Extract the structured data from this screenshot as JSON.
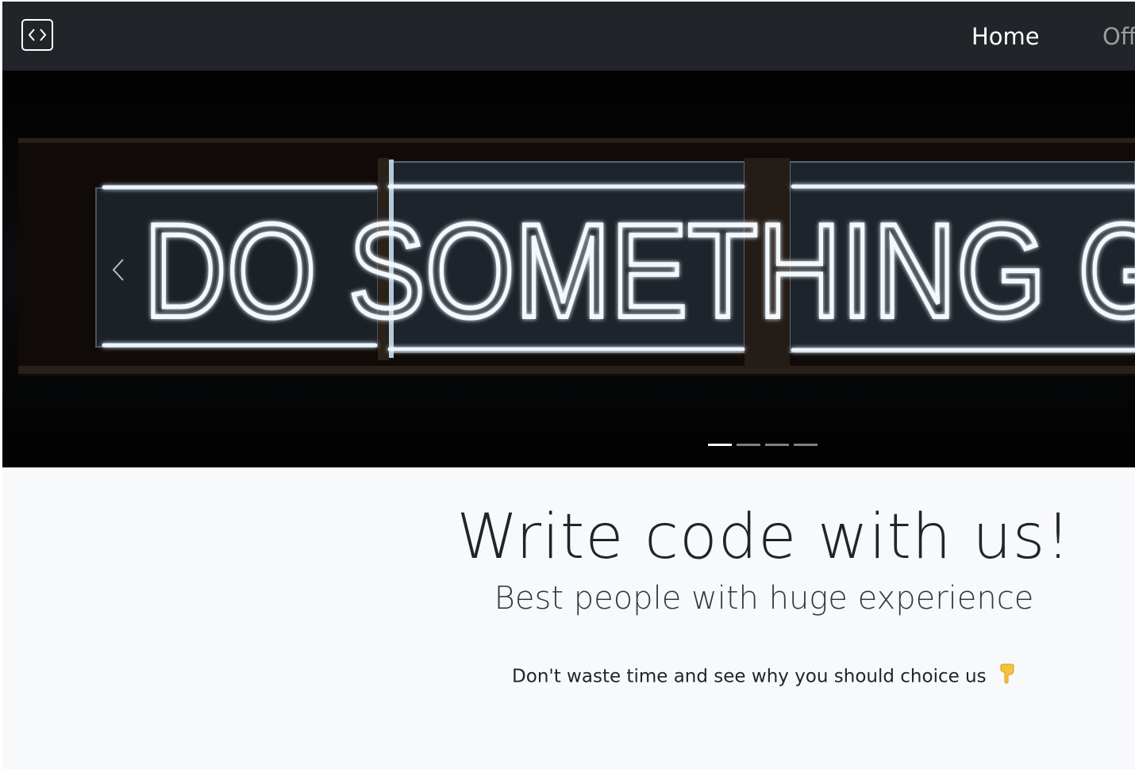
{
  "navbar": {
    "brand_icon": "code-brackets-icon",
    "links": [
      {
        "label": "Home"
      },
      {
        "label": "Off"
      }
    ]
  },
  "carousel": {
    "slide_text": "DO SOMETHING G",
    "prev_icon": "chevron-left-icon",
    "indicator_count": 4,
    "active_index": 0
  },
  "hero": {
    "title": "Write code with us!",
    "subtitle": "Best people with huge experience",
    "cta": "Don't waste time and see why you should choice us",
    "cta_icon": "pointing-down-hand-icon"
  },
  "colors": {
    "navbar_bg": "#212529",
    "page_bg": "#f8f9fa",
    "neon": "#e8f4ff",
    "hand": "#f5c23e"
  }
}
